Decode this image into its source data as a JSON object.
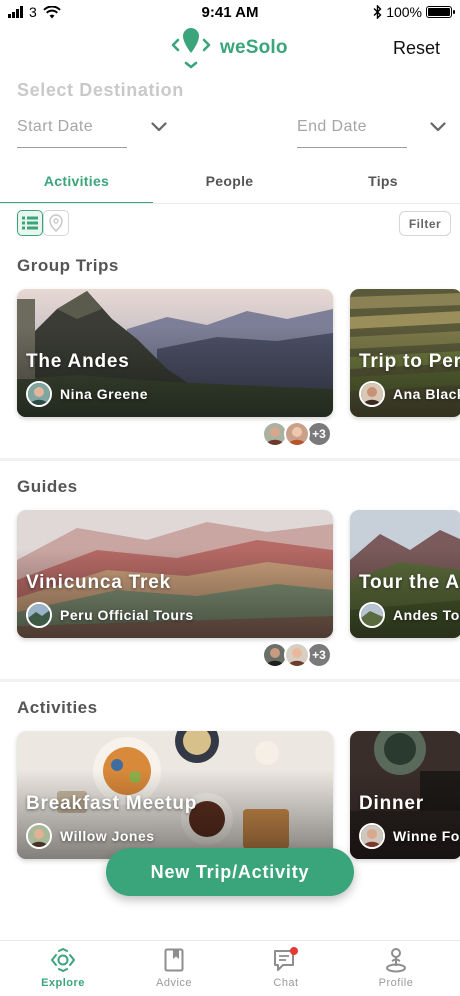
{
  "status_bar": {
    "carrier": "3",
    "time": "9:41 AM",
    "battery": "100%"
  },
  "header": {
    "app_name": "weSolo",
    "reset_label": "Reset"
  },
  "filters": {
    "title": "Select Destination",
    "start_date": "Start Date",
    "end_date": "End Date"
  },
  "tabs": [
    {
      "label": "Activities",
      "active": true
    },
    {
      "label": "People",
      "active": false
    },
    {
      "label": "Tips",
      "active": false
    }
  ],
  "view_toggle": {
    "list_icon": "list-icon",
    "map_icon": "map-pin-icon",
    "filter_label": "Filter"
  },
  "sections": {
    "group_trips": {
      "title": "Group Trips",
      "cards": [
        {
          "title": "The Andes",
          "owner": "Nina Greene"
        },
        {
          "title": "Trip to Peru",
          "owner": "Ana Black"
        }
      ],
      "attendee_more": "+3"
    },
    "guides": {
      "title": "Guides",
      "cards": [
        {
          "title": "Vinicunca Trek",
          "owner": "Peru Official Tours"
        },
        {
          "title": "Tour the Andes",
          "owner": "Andes Tours"
        }
      ],
      "attendee_more": "+3"
    },
    "activities": {
      "title": "Activities",
      "cards": [
        {
          "title": "Breakfast Meetup",
          "owner": "Willow Jones"
        },
        {
          "title": "Dinner",
          "owner": "Winne Fox"
        }
      ]
    }
  },
  "fab_label": "New Trip/Activity",
  "bottom_nav": [
    {
      "label": "Explore",
      "icon": "compass-icon",
      "active": true
    },
    {
      "label": "Advice",
      "icon": "book-icon",
      "active": false
    },
    {
      "label": "Chat",
      "icon": "chat-icon",
      "active": false,
      "badge": true
    },
    {
      "label": "Profile",
      "icon": "profile-pin-icon",
      "active": false
    }
  ],
  "colors": {
    "accent": "#3aa57a",
    "badge": "#e53935"
  }
}
